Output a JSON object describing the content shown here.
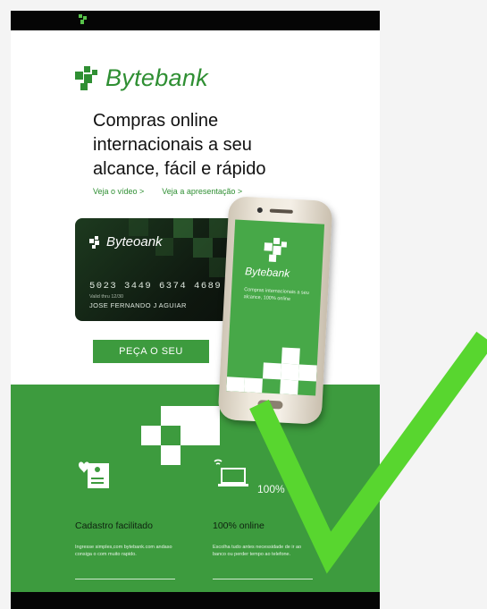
{
  "brand": {
    "name": "Bytebank",
    "color": "#2f8f33",
    "logo_icon": "bytebank-pixel-logo"
  },
  "hero": {
    "headline_lines": [
      "Compras online",
      "internacionais a seu",
      "alcance, fácil e rápido"
    ],
    "link_video": "Veja o vídeo >",
    "link_presentation": "Veja a apresentação >"
  },
  "card": {
    "brand": "Byteoank",
    "number": "5023  3449  6374  4689",
    "valid": "Valid thru  12/30",
    "holder": "JOSE FERNANDO J AGUIAR"
  },
  "cta": {
    "label": "PEÇA O SEU"
  },
  "phone": {
    "brand": "Bytebank",
    "text": "Compras internacionais a seu alcance, 100% online"
  },
  "features": [
    {
      "title": "Cadastro facilitado",
      "desc": "Ingresse simples,com bytebank.com andaso consiga o com muito rapido.",
      "icon": "document-person-icon"
    },
    {
      "title": "100% online",
      "percent": "100%",
      "desc": "Escolha tudo antes necessidade de ir ao banco ou perder tempo ao telefone.",
      "icon": "laptop-wifi-icon"
    }
  ],
  "overlay": {
    "icon": "checkmark-icon",
    "color": "#58d62f"
  },
  "colors": {
    "green": "#3d9b3e",
    "black_bar": "#050505"
  }
}
